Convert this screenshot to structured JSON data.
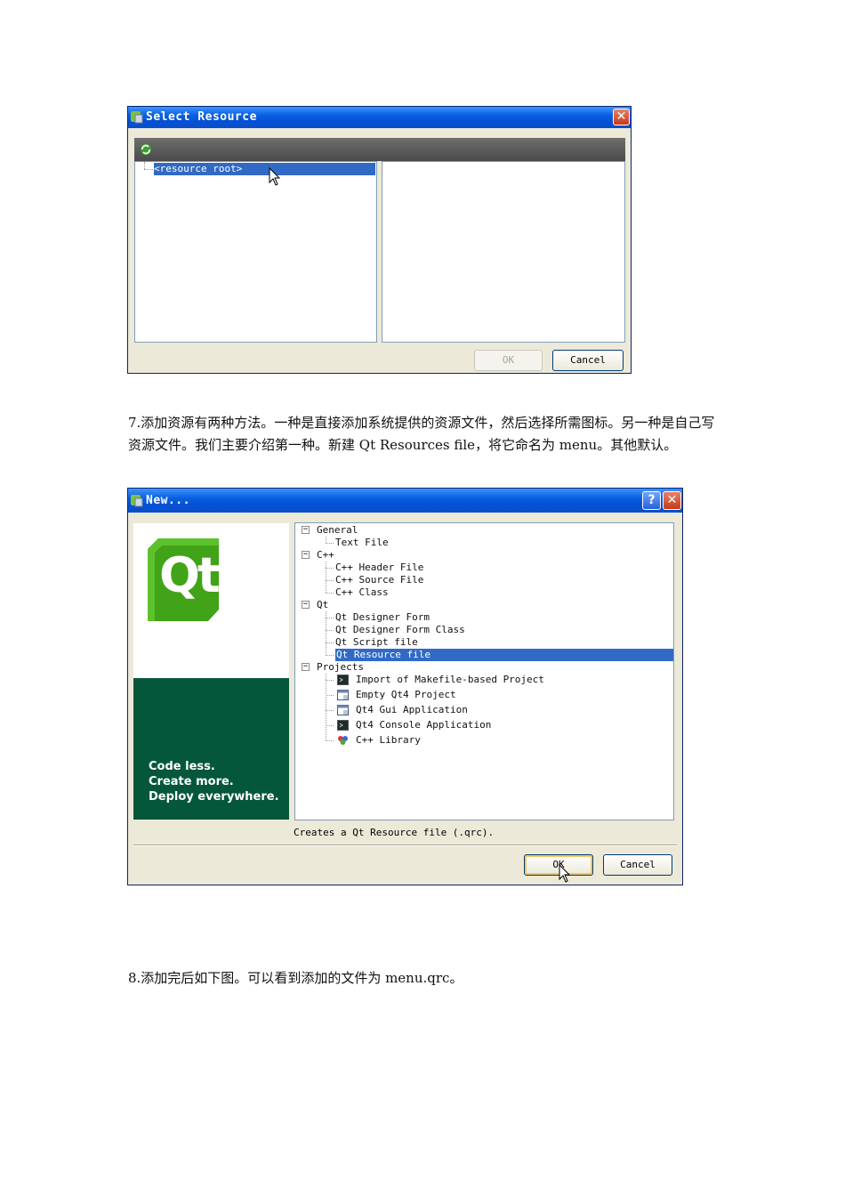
{
  "select_resource_dialog": {
    "title": "Select Resource",
    "close_symbol": "✕",
    "tree_root": "<resource root>",
    "ok_label": "OK",
    "cancel_label": "Cancel"
  },
  "paragraph_7": "7.添加资源有两种方法。一种是直接添加系统提供的资源文件，然后选择所需图标。另一种是自己写资源文件。我们主要介绍第一种。新建 Qt Resources file，将它命名为 menu。其他默认。",
  "new_dialog": {
    "title": "New...",
    "help_symbol": "?",
    "close_symbol": "✕",
    "logo_text": "Qt",
    "slogan": [
      "Code less.",
      "Create more.",
      "Deploy everywhere."
    ],
    "groups": [
      {
        "label": "General",
        "items": [
          {
            "label": "Text File",
            "icon": "none"
          }
        ]
      },
      {
        "label": "C++",
        "items": [
          {
            "label": "C++ Header File",
            "icon": "none"
          },
          {
            "label": "C++ Source File",
            "icon": "none"
          },
          {
            "label": "C++ Class",
            "icon": "none"
          }
        ]
      },
      {
        "label": "Qt",
        "items": [
          {
            "label": "Qt Designer Form",
            "icon": "none"
          },
          {
            "label": "Qt Designer Form Class",
            "icon": "none"
          },
          {
            "label": "Qt Script file",
            "icon": "none"
          },
          {
            "label": "Qt Resource file",
            "icon": "none",
            "selected": true
          }
        ]
      },
      {
        "label": "Projects",
        "items": [
          {
            "label": "Import of Makefile-based Project",
            "icon": "console-icon"
          },
          {
            "label": "Empty Qt4 Project",
            "icon": "window-icon"
          },
          {
            "label": "Qt4 Gui Application",
            "icon": "window-icon"
          },
          {
            "label": "Qt4 Console Application",
            "icon": "console-icon"
          },
          {
            "label": "C++ Library",
            "icon": "library-icon"
          }
        ]
      }
    ],
    "description": "Creates a Qt Resource file (.qrc).",
    "ok_label": "OK",
    "cancel_label": "Cancel",
    "colors": {
      "qt_green": "#41a317",
      "slogan_bg": "#05573b",
      "selection": "#316ac5"
    }
  },
  "paragraph_8": "8.添加完后如下图。可以看到添加的文件为 menu.qrc。"
}
